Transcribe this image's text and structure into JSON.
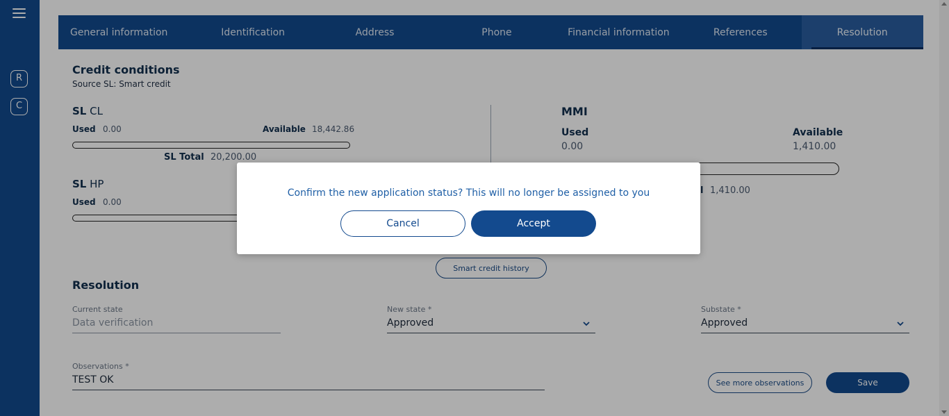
{
  "sidebar": {
    "buttons": [
      "R",
      "C"
    ]
  },
  "tabs": [
    {
      "label": "General information"
    },
    {
      "label": "Identification"
    },
    {
      "label": "Address"
    },
    {
      "label": "Phone"
    },
    {
      "label": "Financial information"
    },
    {
      "label": "References"
    },
    {
      "label": "Resolution"
    }
  ],
  "active_tab": "Resolution",
  "credit": {
    "title": "Credit conditions",
    "source": "Source SL: Smart credit",
    "sl_cl": {
      "prefix": "SL",
      "name": "CL",
      "used_label": "Used",
      "used_value": "0.00",
      "available_label": "Available",
      "available_value": "18,442.86",
      "total_label": "SL Total",
      "total_value": "20,200.00"
    },
    "sl_hp": {
      "prefix": "SL",
      "name": "HP",
      "used_label": "Used",
      "used_value": "0.00"
    },
    "mmi": {
      "title": "MMI",
      "used_label": "Used",
      "used_value": "0.00",
      "available_label": "Available",
      "available_value": "1,410.00",
      "total_label_fragment": "l",
      "total_value": "1,410.00"
    },
    "history_button": "Smart credit history"
  },
  "resolution": {
    "title": "Resolution",
    "current_state_label": "Current state",
    "current_state_value": "Data verification",
    "new_state_label": "New state *",
    "new_state_value": "Approved",
    "substate_label": "Substate *",
    "substate_value": "Approved",
    "observations_label": "Observations *",
    "observations_value": "TEST OK",
    "see_more_button": "See more observations",
    "save_button": "Save"
  },
  "dialog": {
    "message": "Confirm the new application status? This will no longer be assigned to you",
    "cancel": "Cancel",
    "accept": "Accept"
  },
  "colors": {
    "brand": "#134a8e",
    "overlay": "rgba(0,0,0,0.32)"
  }
}
